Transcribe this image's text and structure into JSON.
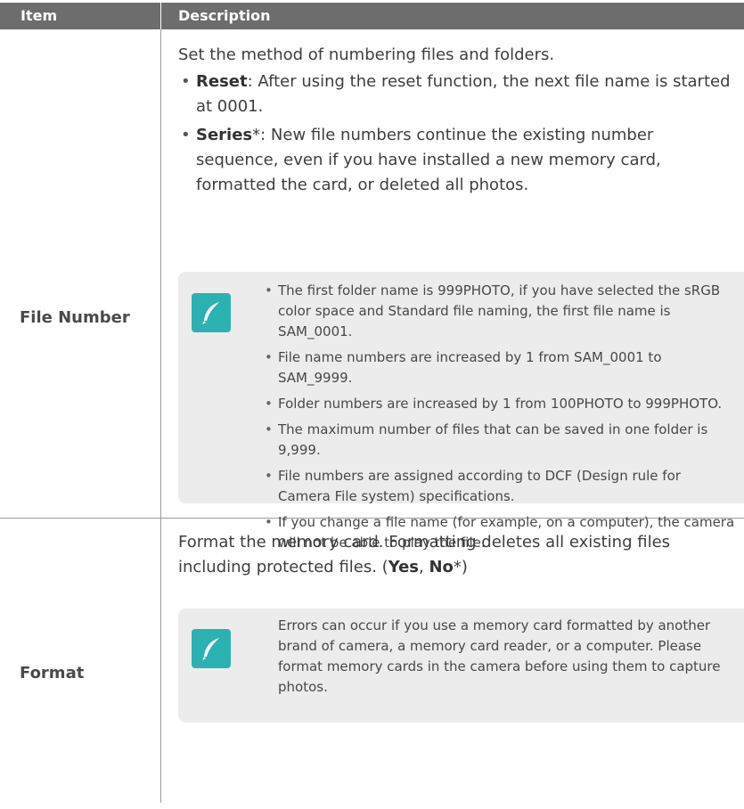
{
  "header": {
    "item": "Item",
    "description": "Description"
  },
  "rows": [
    {
      "item": "File Number",
      "intro": "Set the method of numbering files and folders.",
      "options": [
        {
          "name": "Reset",
          "text": ": After using the reset function, the next file name is started at 0001."
        },
        {
          "name": "Series",
          "mark": "*",
          "text": ": New file numbers continue the existing number sequence, even if you have installed a new memory card, formatted the card, or deleted all photos."
        }
      ],
      "notes": [
        "The first folder name is 999PHOTO, if you have selected the sRGB color space and Standard file naming, the first file name is SAM_0001.",
        "File name numbers are increased by 1 from SAM_0001 to SAM_9999.",
        "Folder numbers are increased by 1 from 100PHOTO to 999PHOTO.",
        "The maximum number of files that can be saved in one folder is 9,999.",
        "File numbers are assigned according to DCF (Design rule for Camera File system) specifications.",
        "If you change a file name (for example, on a computer), the camera will not be able to play the file."
      ]
    },
    {
      "item": "Format",
      "intro": "Format the memory card. Formatting deletes all existing files including protected files. (",
      "yes": "Yes",
      "comma": ", ",
      "no": "No",
      "mark": "*",
      "close": ")",
      "note": "Errors can occur if you use a memory card formatted by another brand of camera, a memory card reader, or a computer. Please format memory cards in the camera before using them to capture photos."
    }
  ],
  "icons": {
    "note": "pen-note-icon"
  },
  "colors": {
    "header_bg": "#6d6d6d",
    "note_bg": "#ececec",
    "icon_bg": "#2bb1b1"
  }
}
